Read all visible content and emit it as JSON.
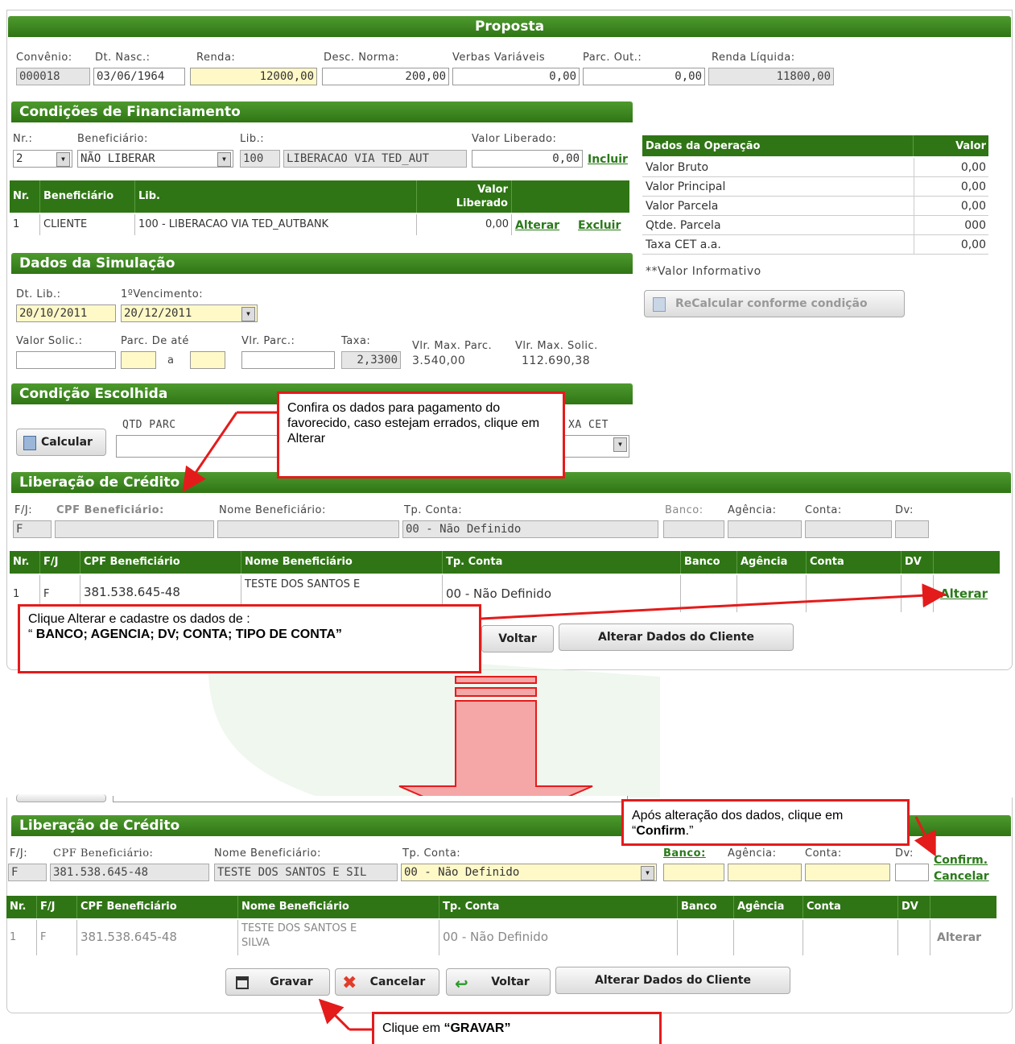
{
  "proposta": {
    "title": "Proposta",
    "labels": {
      "convenio": "Convênio:",
      "dt_nasc": "Dt. Nasc.:",
      "renda": "Renda:",
      "desc_norma": "Desc. Norma:",
      "verbas": "Verbas Variáveis",
      "parc_out": "Parc. Out.:",
      "renda_liquida": "Renda Líquida:"
    },
    "values": {
      "convenio": "000018",
      "dt_nasc": "03/06/1964",
      "renda": "12000,00",
      "desc_norma": "200,00",
      "verbas": "0,00",
      "parc_out": "0,00",
      "renda_liquida": "11800,00"
    }
  },
  "condicoes": {
    "title": "Condições de Financiamento",
    "labels": {
      "nr": "Nr.:",
      "beneficiario": "Beneficiário:",
      "lib": "Lib.:",
      "valor_liberado": "Valor Liberado:"
    },
    "values": {
      "nr": "2",
      "beneficiario": "NÃO LIBERAR",
      "lib_code": "100",
      "lib_desc": "LIBERACAO VIA TED_AUT",
      "valor_liberado": "0,00"
    },
    "incluir": "Incluir",
    "table": {
      "headers": [
        "Nr.",
        "Beneficiário",
        "Lib.",
        "Valor Liberado"
      ],
      "rows": [
        {
          "nr": "1",
          "beneficiario": "CLIENTE",
          "lib": "100  -  LIBERACAO VIA TED_AUTBANK",
          "valor": "0,00",
          "alterar": "Alterar",
          "excluir": "Excluir"
        }
      ]
    }
  },
  "dados_operacao": {
    "header": "Dados da Operação",
    "valor_header": "Valor",
    "rows": [
      {
        "label": "Valor Bruto",
        "value": "0,00"
      },
      {
        "label": "Valor Principal",
        "value": "0,00"
      },
      {
        "label": "Valor Parcela",
        "value": "0,00"
      },
      {
        "label": "Qtde. Parcela",
        "value": "000"
      },
      {
        "label": "Taxa CET a.a.",
        "value": "0,00"
      }
    ],
    "note": "**Valor Informativo",
    "recalc": "ReCalcular conforme condição"
  },
  "simulacao": {
    "title": "Dados da Simulação",
    "labels": {
      "dt_lib": "Dt. Lib.:",
      "vencimento": "1ºVencimento:",
      "valor_solic": "Valor Solic.:",
      "parc_de_ate": "Parc. De até",
      "a": "a",
      "vlr_parc": "Vlr. Parc.:",
      "taxa": "Taxa:",
      "max_parc": "Vlr. Max. Parc.",
      "max_solic": "Vlr. Max. Solic."
    },
    "values": {
      "dt_lib": "20/10/2011",
      "vencimento": "20/12/2011",
      "taxa": "2,3300",
      "max_parc": "3.540,00",
      "max_solic": "112.690,38"
    }
  },
  "condicao_escolhida": {
    "title": "Condição Escolhida",
    "calcular": "Calcular",
    "qtd_parc": "QTD PARC",
    "taxa_cet": "XA CET"
  },
  "liberacao": {
    "title": "Liberação de Crédito",
    "labels": {
      "fj": "F/J:",
      "cpf": "CPF Beneficiário:",
      "nome": "Nome Beneficiário:",
      "tp_conta": "Tp. Conta:",
      "banco": "Banco:",
      "agencia": "Agência:",
      "conta": "Conta:",
      "dv": "Dv:"
    },
    "values": {
      "fj": "F",
      "tp_conta": "00 - Não Definido"
    },
    "table": {
      "headers": [
        "Nr.",
        "F/J",
        "CPF Beneficiário",
        "Nome Beneficiário",
        "Tp. Conta",
        "Banco",
        "Agência",
        "Conta",
        "DV"
      ],
      "row": {
        "nr": "1",
        "fj": "F",
        "cpf": "381.538.645-48",
        "nome": "TESTE DOS SANTOS E",
        "tp": "00 - Não Definido",
        "alterar": "Alterar"
      }
    },
    "buttons": {
      "voltar": "Voltar",
      "alterar_cliente": "Alterar Dados do Cliente"
    }
  },
  "liberacao2": {
    "title": "Liberação de Crédito",
    "labels": {
      "fj": "F/J:",
      "cpf": "CPF Beneficiário:",
      "nome": "Nome Beneficiário:",
      "tp_conta": "Tp. Conta:",
      "banco": "Banco:",
      "agencia": "Agência:",
      "conta": "Conta:",
      "dv": "Dv:"
    },
    "values": {
      "fj": "F",
      "cpf": "381.538.645-48",
      "nome": "TESTE DOS SANTOS E SIL",
      "tp_conta": "00 - Não Definido"
    },
    "confirm": "Confirm.",
    "cancelar": "Cancelar",
    "table": {
      "headers": [
        "Nr.",
        "F/J",
        "CPF Beneficiário",
        "Nome Beneficiário",
        "Tp. Conta",
        "Banco",
        "Agência",
        "Conta",
        "DV"
      ],
      "row": {
        "nr": "1",
        "fj": "F",
        "cpf": "381.538.645-48",
        "nome1": "TESTE DOS SANTOS E",
        "nome2": "SILVA",
        "tp": "00 - Não Definido",
        "alterar": "Alterar"
      }
    },
    "buttons": {
      "gravar": "Gravar",
      "cancelar": "Cancelar",
      "voltar": "Voltar",
      "alterar_cliente": "Alterar Dados do Cliente"
    }
  },
  "callouts": {
    "c1": "Confira os dados para pagamento do favorecido, caso estejam errados, clique em Alterar",
    "c2_line1": "Clique Alterar e cadastre os dados de :",
    "c2_line2_prefix": "“ ",
    "c2_line2_bold": "BANCO; AGENCIA; DV; CONTA; TIPO DE CONTA”",
    "c3_pre": "Após alteração dos dados, clique em “",
    "c3_bold": "Confirm",
    "c3_post": ".”",
    "c4_pre": "Clique em ",
    "c4_bold": "“GRAVAR”"
  },
  "colors": {
    "green": "#2f7515",
    "red": "#e41b1b",
    "arrow": "#f5a6a6"
  }
}
